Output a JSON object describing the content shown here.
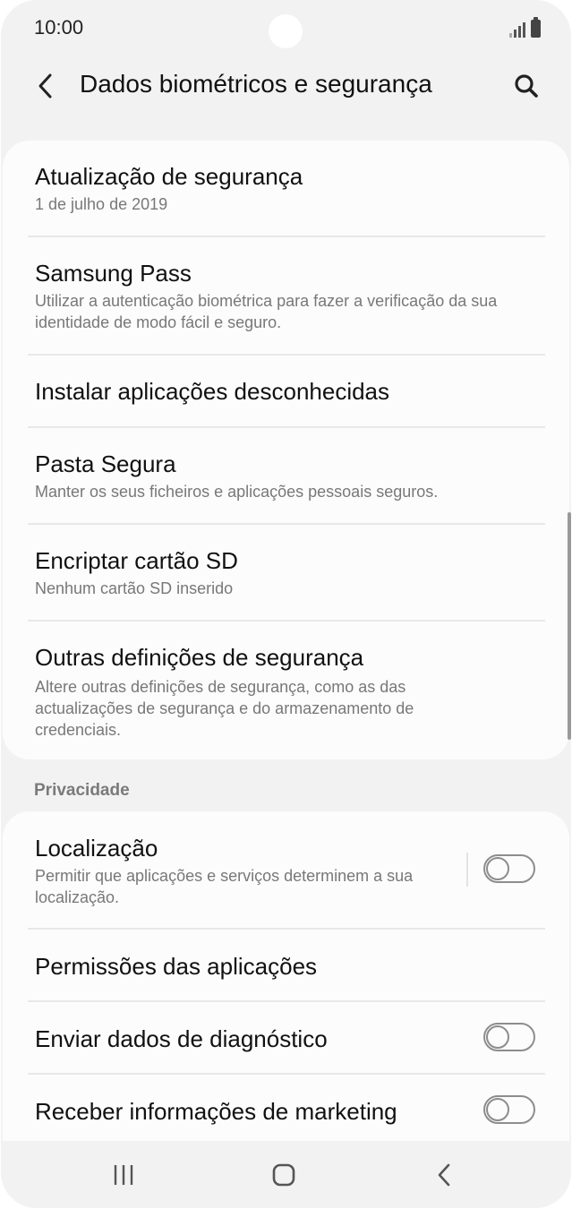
{
  "status_bar": {
    "time": "10:00"
  },
  "header": {
    "title": "Dados biométricos e segurança",
    "back_icon": "chevron-left-icon",
    "search_icon": "search-icon"
  },
  "security_items": [
    {
      "title": "Atualização de segurança",
      "subtitle": "1 de julho de 2019"
    },
    {
      "title": "Samsung Pass",
      "subtitle": "Utilizar a autenticação biométrica para fazer a verificação da sua identidade de modo fácil e seguro."
    },
    {
      "title": "Instalar aplicações desconhecidas"
    },
    {
      "title": "Pasta Segura",
      "subtitle": "Manter os seus ficheiros e aplicações pessoais seguros."
    },
    {
      "title": "Encriptar cartão SD",
      "subtitle": "Nenhum cartão SD inserido"
    },
    {
      "title": "Outras definições de segurança",
      "subtitle": "Altere outras definições de segurança, como as das actualizações de segurança e do armazenamento de credenciais."
    }
  ],
  "privacy_section": {
    "header": "Privacidade",
    "items": [
      {
        "title": "Localização",
        "subtitle": "Permitir que aplicações e serviços determinem a sua localização.",
        "toggle": false
      },
      {
        "title": "Permissões das aplicações"
      },
      {
        "title": "Enviar dados de diagnóstico",
        "toggle": false
      },
      {
        "title": "Receber informações de marketing",
        "toggle": false
      }
    ]
  },
  "colors": {
    "background": "#f2f2f2",
    "card": "#fcfcfc",
    "title_text": "#111111",
    "subtitle_text": "#787878",
    "toggle_off": "#8d8d8d"
  }
}
